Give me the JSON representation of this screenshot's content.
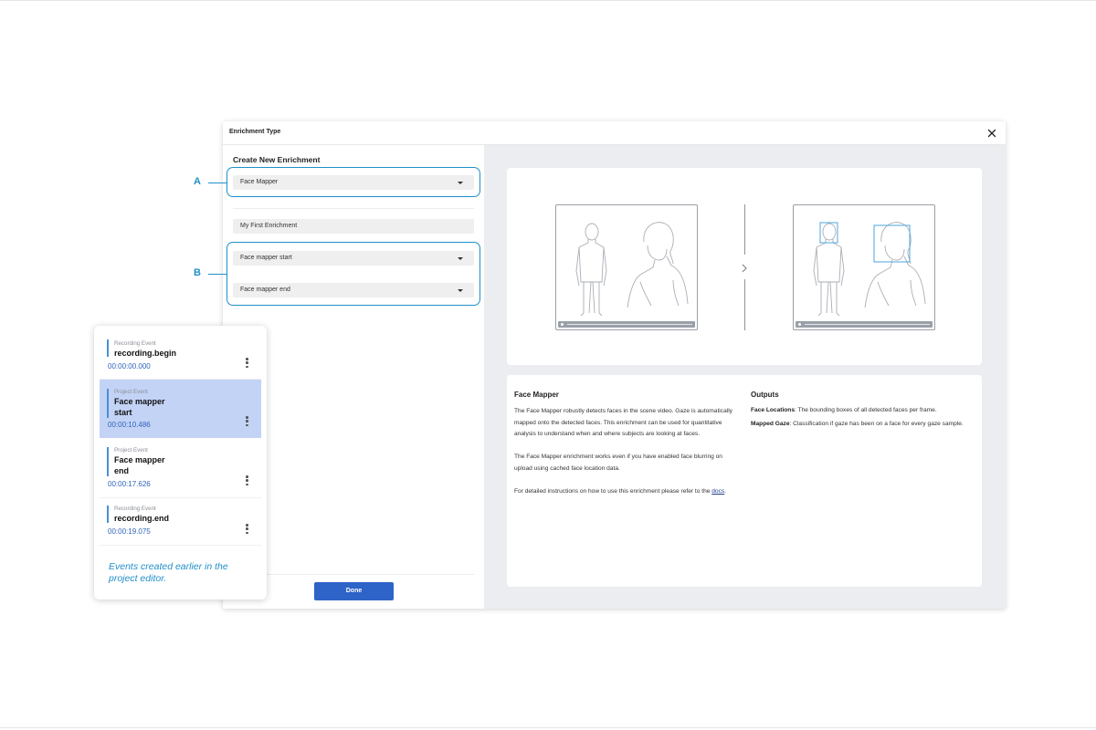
{
  "dialog": {
    "title": "Enrichment Type",
    "close_icon": "close-icon"
  },
  "form": {
    "section_title": "Create New Enrichment",
    "enrichment_type": "Face Mapper",
    "enrichment_name": "My First Enrichment",
    "start_event": "Face mapper start",
    "end_event": "Face mapper end",
    "done_label": "Done"
  },
  "annotations": {
    "a": "A",
    "b": "B"
  },
  "description": {
    "title": "Face Mapper",
    "p1": "The Face Mapper robustly detects faces in the scene video. Gaze is automatically mapped onto the detected faces. This enrichment can be used for quantitative analysis to understand when and where subjects are looking at faces.",
    "p2": "The Face Mapper enrichment works even if you have enabled face blurring on upload using cached face location data.",
    "p3_prefix": "For detailed instructions on how to use this enrichment please refer to the ",
    "p3_link": "docs",
    "p3_suffix": "."
  },
  "outputs": {
    "title": "Outputs",
    "items": [
      {
        "label": "Face Locations",
        "text": ": The bounding boxes of all detected faces per frame."
      },
      {
        "label": "Mapped Gaze",
        "text": ": Classification if gaze has been on a face for every gaze sample."
      }
    ]
  },
  "events": {
    "items": [
      {
        "type": "Recording Event",
        "name": "recording.begin",
        "time": "00:00:00.000",
        "selected": false
      },
      {
        "type": "Project Event",
        "name": "Face mapper start",
        "time": "00:00:10.486",
        "selected": true
      },
      {
        "type": "Project Event",
        "name": "Face mapper end",
        "time": "00:00:17.626",
        "selected": false
      },
      {
        "type": "Recording Event",
        "name": "recording.end",
        "time": "00:00:19.075",
        "selected": false
      }
    ],
    "name_lines": [
      [
        "recording.begin"
      ],
      [
        "Face mapper",
        "start"
      ],
      [
        "Face mapper",
        "end"
      ],
      [
        "recording.end"
      ]
    ],
    "note": "Events created earlier in the project editor."
  },
  "colors": {
    "accent": "#1f8fc9",
    "primary_button": "#2e63c7",
    "selected_row": "#c3d3f6",
    "time_text": "#2f63b8"
  }
}
